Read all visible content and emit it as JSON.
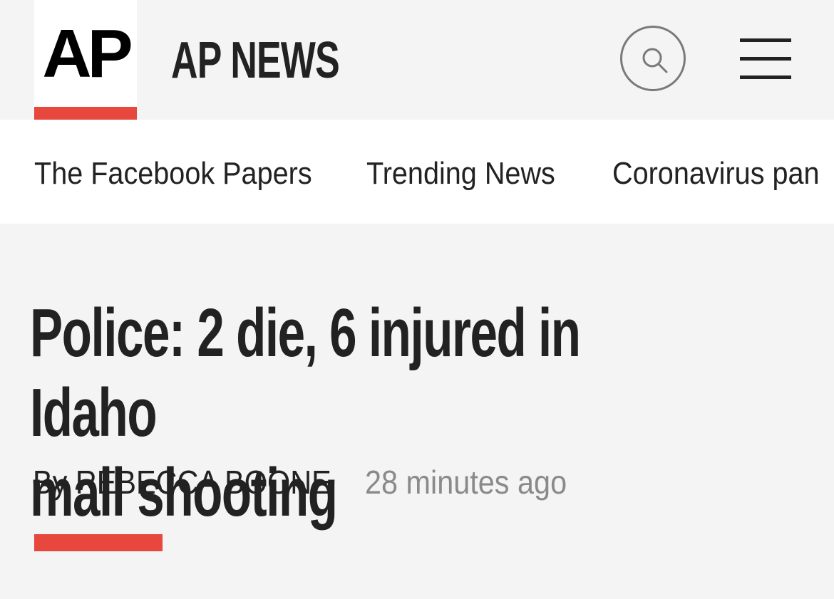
{
  "header": {
    "logo_text": "AP",
    "site_name": "AP NEWS",
    "search_icon": "search-icon",
    "menu_icon": "hamburger-menu-icon",
    "accent_color": "#e8473e"
  },
  "nav": {
    "items": [
      {
        "label": "The Facebook Papers"
      },
      {
        "label": "Trending News"
      },
      {
        "label": "Coronavirus pan"
      }
    ]
  },
  "article": {
    "headline_line1": "Police: 2 die, 6 injured in Idaho",
    "headline_line2": "mall shooting",
    "byline": "By REBECCA BOONE",
    "timestamp": "28 minutes ago"
  }
}
